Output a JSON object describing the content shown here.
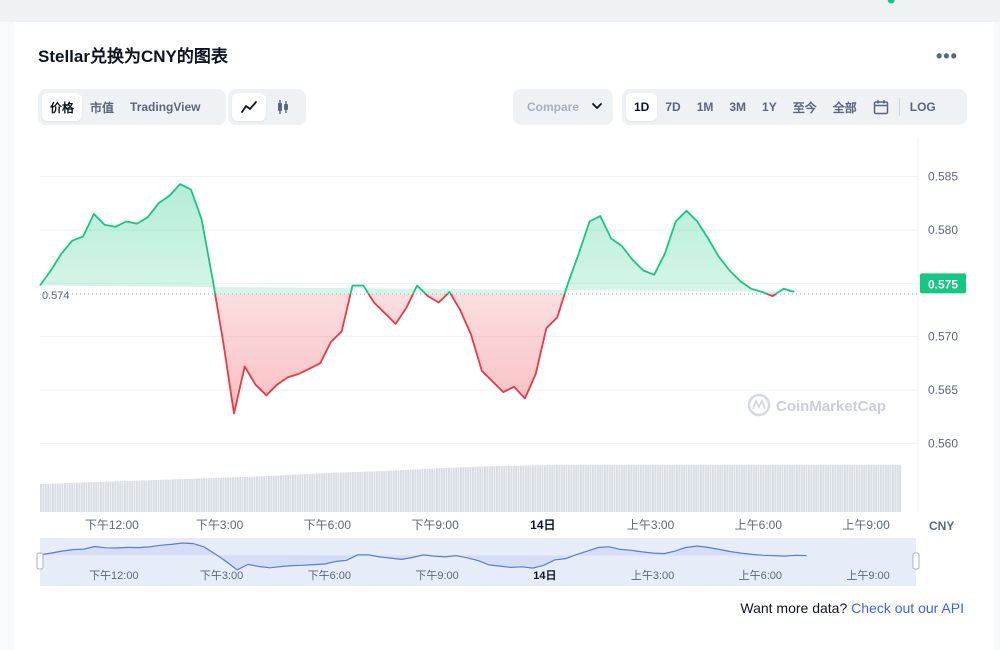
{
  "title": "Stellar兑换为CNY的图表",
  "toolbar": {
    "type_tabs": [
      "价格",
      "市值",
      "TradingView"
    ],
    "active_type": "价格",
    "compare_label": "Compare",
    "ranges": [
      "1D",
      "7D",
      "1M",
      "3M",
      "1Y",
      "至今",
      "全部"
    ],
    "active_range": "1D",
    "log_label": "LOG"
  },
  "colors": {
    "up": "#16c784",
    "down": "#ea3943",
    "accent": "#3861fb"
  },
  "icons": [
    "more-icon",
    "line-chart-icon",
    "candlestick-icon",
    "chevron-down-icon",
    "calendar-icon",
    "coinmarketcap-logo-icon"
  ],
  "chart_data": {
    "type": "line",
    "currency_label": "CNY",
    "baseline": 0.574,
    "baseline_label": "0.574",
    "current_value": 0.575,
    "current_label": "0.575",
    "watermark": "CoinMarketCap",
    "ylim": [
      0.5575,
      0.5875
    ],
    "y_ticks": [
      0.585,
      0.58,
      0.575,
      0.57,
      0.565,
      0.56
    ],
    "y_tick_labels": [
      "0.585",
      "0.580",
      "0.575",
      "0.570",
      "0.565",
      "0.560"
    ],
    "x_ticks": [
      {
        "label": "下午12:00",
        "hour": 2.0,
        "bold": false
      },
      {
        "label": "下午3:00",
        "hour": 5.0,
        "bold": false
      },
      {
        "label": "下午6:00",
        "hour": 8.0,
        "bold": false
      },
      {
        "label": "下午9:00",
        "hour": 11.0,
        "bold": false
      },
      {
        "label": "14日",
        "hour": 14.0,
        "bold": true
      },
      {
        "label": "上午3:00",
        "hour": 17.0,
        "bold": false
      },
      {
        "label": "上午6:00",
        "hour": 20.0,
        "bold": false
      },
      {
        "label": "上午9:00",
        "hour": 23.0,
        "bold": false
      }
    ],
    "x_range": [
      0.0,
      24.0
    ],
    "hours": [
      0.0,
      0.3,
      0.6,
      0.9,
      1.2,
      1.5,
      1.8,
      2.1,
      2.4,
      2.7,
      3.0,
      3.3,
      3.6,
      3.9,
      4.2,
      4.5,
      4.8,
      5.1,
      5.4,
      5.7,
      6.0,
      6.3,
      6.6,
      6.9,
      7.2,
      7.5,
      7.8,
      8.1,
      8.4,
      8.7,
      9.0,
      9.3,
      9.6,
      9.9,
      10.2,
      10.5,
      10.8,
      11.1,
      11.4,
      11.7,
      12.0,
      12.3,
      12.6,
      12.9,
      13.2,
      13.5,
      13.8,
      14.1,
      14.4,
      14.7,
      15.0,
      15.3,
      15.6,
      15.9,
      16.2,
      16.5,
      16.8,
      17.1,
      17.4,
      17.7,
      18.0,
      18.3,
      18.6,
      18.9,
      19.2,
      19.5,
      19.8,
      20.1,
      20.4,
      20.7,
      21.0,
      21.3,
      21.6,
      21.9,
      22.2,
      22.5,
      22.8,
      23.1,
      23.4,
      23.7
    ],
    "values": [
      0.5748,
      0.5762,
      0.5778,
      0.579,
      0.5794,
      0.5815,
      0.5805,
      0.5803,
      0.5808,
      0.5806,
      0.5812,
      0.5825,
      0.5832,
      0.5843,
      0.5838,
      0.581,
      0.5755,
      0.5695,
      0.5628,
      0.5672,
      0.5655,
      0.5645,
      0.5655,
      0.5662,
      0.5665,
      0.567,
      0.5675,
      0.5695,
      0.5705,
      0.5748,
      0.5748,
      0.5732,
      0.5722,
      0.5712,
      0.5727,
      0.5748,
      0.5738,
      0.5732,
      0.5742,
      0.5725,
      0.5702,
      0.5668,
      0.5658,
      0.5648,
      0.5653,
      0.5642,
      0.5665,
      0.5708,
      0.5718,
      0.575,
      0.5778,
      0.5808,
      0.5813,
      0.5792,
      0.5785,
      0.5772,
      0.5762,
      0.5758,
      0.5778,
      0.5808,
      0.5818,
      0.5808,
      0.5792,
      0.5775,
      0.5762,
      0.5752,
      0.5745,
      0.5742,
      0.5738,
      0.5745,
      0.5742
    ],
    "volume_levels": [
      0.28,
      0.3,
      0.32,
      0.34,
      0.36,
      0.39,
      0.41,
      0.44,
      0.46,
      0.47,
      0.47,
      0.47,
      0.47,
      0.47,
      0.47,
      0.47
    ],
    "navigator_labels": [
      {
        "label": "下午12:00",
        "bold": false
      },
      {
        "label": "下午3:00",
        "bold": false
      },
      {
        "label": "下午6:00",
        "bold": false
      },
      {
        "label": "下午9:00",
        "bold": false
      },
      {
        "label": "14日",
        "bold": true
      },
      {
        "label": "上午3:00",
        "bold": false
      },
      {
        "label": "上午6:00",
        "bold": false
      },
      {
        "label": "上午9:00",
        "bold": false
      }
    ]
  },
  "footer": {
    "text": "Want more data?",
    "link": "Check out our API"
  }
}
